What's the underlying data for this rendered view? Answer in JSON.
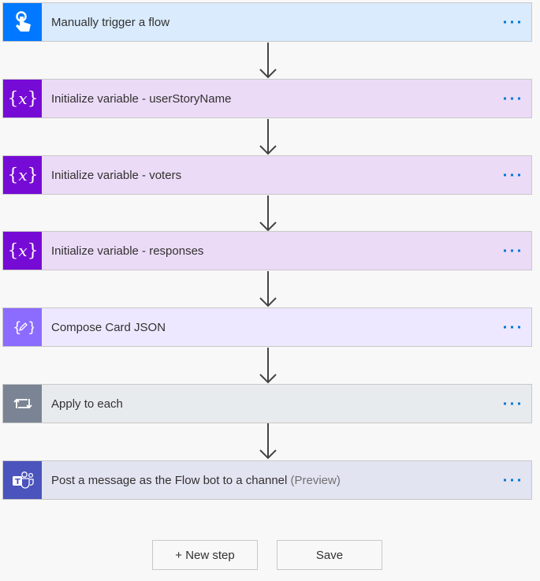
{
  "steps": [
    {
      "label": "Manually trigger a flow",
      "suffix": "",
      "icon": "hand-touch-icon",
      "icon_bg": "#0078ff",
      "card_bg": "#d9ebfd"
    },
    {
      "label": "Initialize variable - userStoryName",
      "suffix": "",
      "icon": "variable-icon",
      "icon_bg": "#770bd6",
      "card_bg": "#ebdbf7"
    },
    {
      "label": "Initialize variable - voters",
      "suffix": "",
      "icon": "variable-icon",
      "icon_bg": "#770bd6",
      "card_bg": "#ebdbf7"
    },
    {
      "label": "Initialize variable - responses",
      "suffix": "",
      "icon": "variable-icon",
      "icon_bg": "#770bd6",
      "card_bg": "#ebdbf7"
    },
    {
      "label": "Compose Card JSON",
      "suffix": "",
      "icon": "compose-icon",
      "icon_bg": "#8c6cff",
      "card_bg": "#ede8ff"
    },
    {
      "label": "Apply to each",
      "suffix": "",
      "icon": "loop-icon",
      "icon_bg": "#7a8494",
      "card_bg": "#e8ebee"
    },
    {
      "label": "Post a message as the Flow bot to a channel",
      "suffix": "(Preview)",
      "icon": "teams-icon",
      "icon_bg": "#4b53bc",
      "card_bg": "#e3e4f2"
    }
  ],
  "more_icon": "ellipsis-icon",
  "accent": "#0078d4",
  "buttons": {
    "new_step": "+ New step",
    "save": "Save"
  }
}
